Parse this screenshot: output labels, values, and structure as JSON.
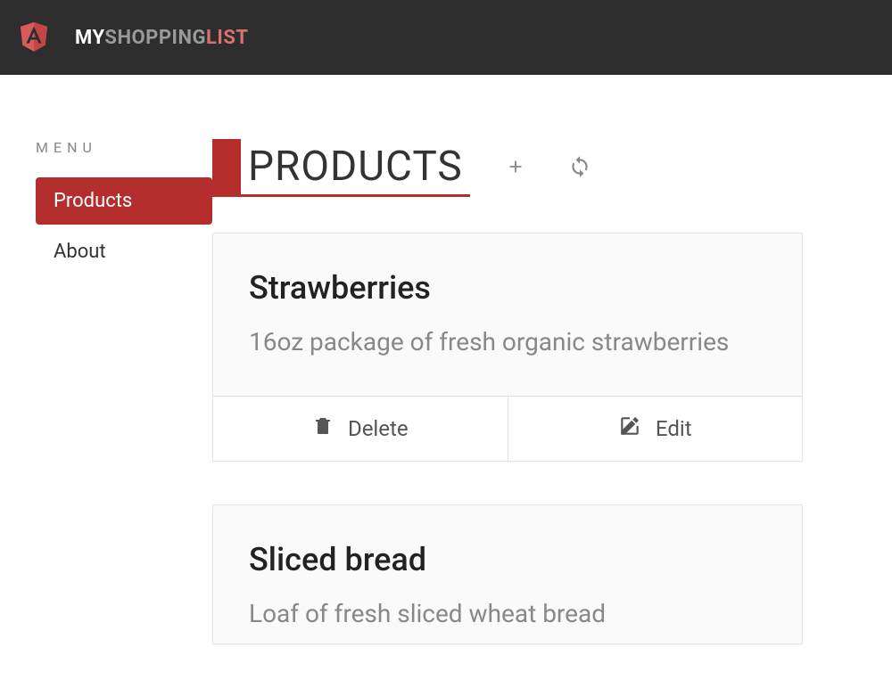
{
  "brand": {
    "part1": "MY",
    "part2": "SHOPPING",
    "part3": "LIST"
  },
  "sidebar": {
    "menu_label": "MENU",
    "items": [
      {
        "label": "Products",
        "active": true
      },
      {
        "label": "About",
        "active": false
      }
    ]
  },
  "page": {
    "title": "PRODUCTS"
  },
  "products": [
    {
      "name": "Strawberries",
      "description": "16oz package of fresh organic strawberries",
      "delete_label": "Delete",
      "edit_label": "Edit"
    },
    {
      "name": "Sliced bread",
      "description": "Loaf of fresh sliced wheat bread"
    }
  ]
}
